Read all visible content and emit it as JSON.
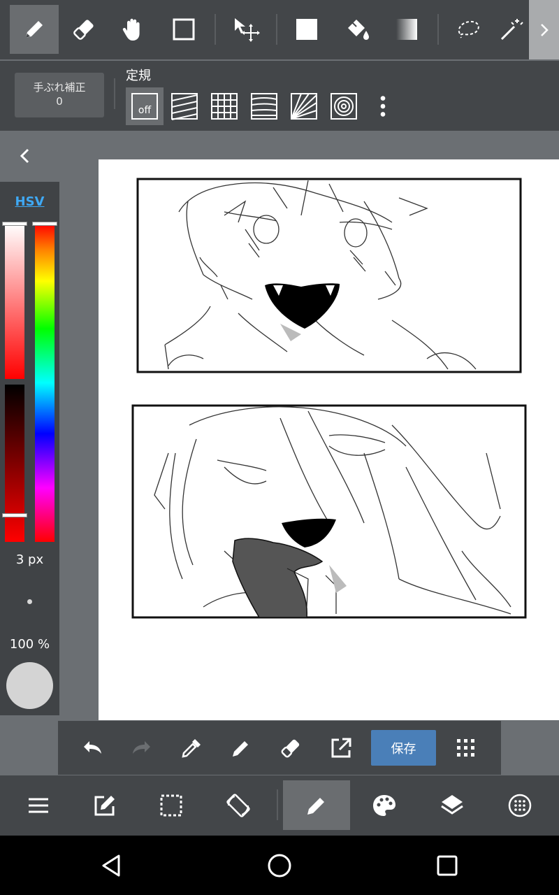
{
  "top_toolbar": {
    "tools": [
      {
        "name": "pen-tool",
        "icon": "pen-icon",
        "active": true
      },
      {
        "name": "eraser-tool",
        "icon": "eraser-icon"
      },
      {
        "name": "hand-tool",
        "icon": "hand-icon"
      },
      {
        "name": "shape-tool",
        "icon": "square-outline-icon"
      },
      {
        "name": "move-tool",
        "icon": "move-icon"
      },
      {
        "name": "fill-rect-tool",
        "icon": "square-fill-icon"
      },
      {
        "name": "bucket-tool",
        "icon": "bucket-icon"
      },
      {
        "name": "gradient-tool",
        "icon": "gradient-icon"
      },
      {
        "name": "lasso-tool",
        "icon": "lasso-icon"
      },
      {
        "name": "magic-wand-tool",
        "icon": "magic-wand-icon"
      }
    ]
  },
  "sub_toolbar": {
    "stabilizer_label": "手ぶれ補正",
    "stabilizer_value": "0",
    "ruler_label": "定規",
    "ruler_off_label": "off"
  },
  "color_panel": {
    "mode_label": "HSV",
    "brush_size": "3 px",
    "opacity": "100 %",
    "current_color": "#d4d4d4"
  },
  "quick_bar": {
    "save_label": "保存"
  },
  "colors": {
    "toolbar_bg": "#434649",
    "active_bg": "#6a6d70",
    "accent_blue": "#4a7fb8",
    "hsv_blue": "#3fa9f5"
  }
}
